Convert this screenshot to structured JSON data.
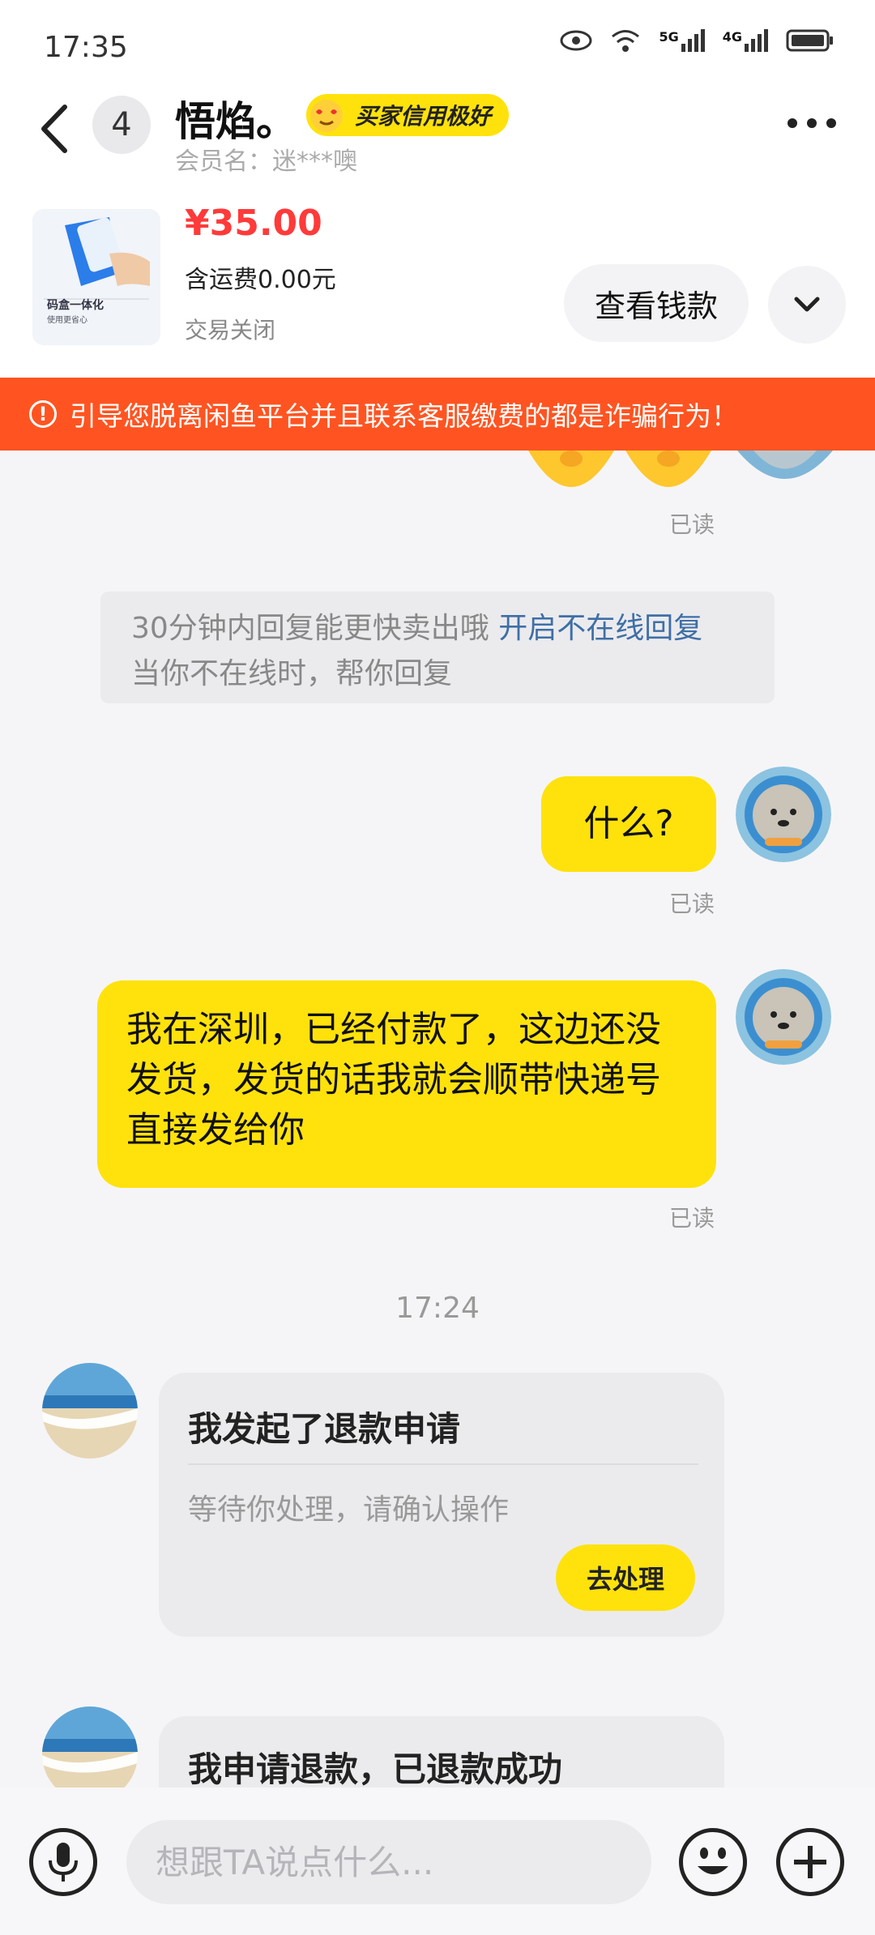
{
  "status_bar": {
    "time": "17:35",
    "network_5g": "5G",
    "network_4g": "4G"
  },
  "header": {
    "unread_count": "4",
    "contact_name": "悟焰。",
    "credit_badge": "买家信用极好",
    "member_label": "会员名：",
    "member_name": "迷***噢"
  },
  "product": {
    "price": "¥35.00",
    "shipping": "含运费0.00元",
    "status": "交易关闭",
    "view_money_label": "查看钱款",
    "image_caption": "码盒一体化",
    "image_subcaption": "使用更省心"
  },
  "warning": {
    "text": "引导您脱离闲鱼平台并且联系客服缴费的都是诈骗行为！"
  },
  "chat": {
    "read_label": "已读",
    "hint_text": "30分钟内回复能更快卖出哦",
    "hint_link": "开启不在线回复",
    "hint_sub": "当你不在线时，帮你回复",
    "msg1": "什么?",
    "msg2": "我在深圳，已经付款了，这边还没发货，发货的话我就会顺带快递号直接发给你",
    "timestamp": "17:24",
    "refund_card": {
      "title": "我发起了退款申请",
      "subtitle": "等待你处理，请确认操作",
      "action": "去处理"
    },
    "refund_done_title": "我申请退款，已退款成功"
  },
  "input": {
    "placeholder": "想跟TA说点什么..."
  },
  "colors": {
    "brand_yellow": "#ffe20c",
    "warning_orange": "#ff5421",
    "price_red": "#ff3a3a",
    "link_blue": "#3f6fa6"
  }
}
